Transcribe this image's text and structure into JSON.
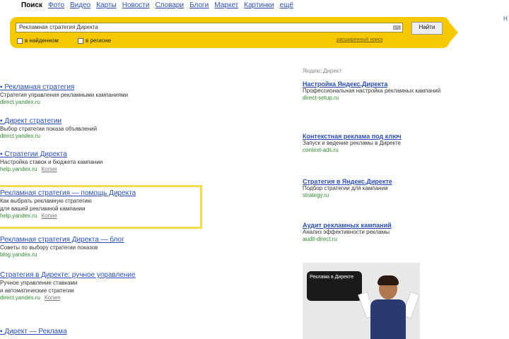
{
  "nav": {
    "items": [
      "Поиск",
      "Фото",
      "Видео",
      "Карты",
      "Новости",
      "Словари",
      "Блоги",
      "Маркет",
      "Картинки",
      "ещё"
    ]
  },
  "search": {
    "query": "Рекламная стратегия Директа",
    "button": "Найти",
    "options": [
      "в найденном",
      "в регионе"
    ],
    "advanced": "расширенный поиск"
  },
  "results": [
    {
      "title": "Рекламная стратегия",
      "snippet": "Стратегия управления рекламными кампаниями",
      "url": "direct.yandex.ru"
    },
    {
      "title": "Директ стратегии",
      "snippet": "Выбор стратегии показа объявлений",
      "url": "direct.yandex.ru"
    },
    {
      "title": "Стратегии Директа",
      "snippet": "Настройка ставок и бюджета кампании",
      "url": "help.yandex.ru",
      "copy": "Копия"
    },
    {
      "title": "Рекламная стратегия — помощь Директа",
      "snippet1": "Как выбрать рекламную стратегию",
      "snippet2": "для вашей рекламной кампании",
      "url": "help.yandex.ru",
      "copy": "Копия"
    },
    {
      "title": "Рекламная стратегия Директа — блог",
      "snippet": "Советы по выбору стратегии показов",
      "url": "blog.yandex.ru"
    },
    {
      "title": "Стратегия в Директе: ручное управление",
      "snippet1": "Ручное управление ставками",
      "snippet2": "и автоматические стратегии",
      "url": "direct.yandex.ru",
      "copy": "Копия"
    },
    {
      "title": "Директ — Реклама",
      "snippet": "",
      "url": ""
    }
  ],
  "ads": {
    "header": "Яндекс.Директ",
    "items": [
      {
        "title": "Настройка Яндекс.Директа",
        "snippet": "Профессиональная настройка рекламных кампаний",
        "url": "direct-setup.ru"
      },
      {
        "title": "Контекстная реклама под ключ",
        "snippet": "Запуск и ведение рекламы в Директе",
        "url": "context-ads.ru"
      },
      {
        "title": "Стратегия в Яндекс.Директе",
        "snippet": "Подбор стратегии для кампании",
        "url": "strategy.ru"
      },
      {
        "title": "Аудит рекламных кампаний",
        "snippet": "Анализ эффективности рекламы",
        "url": "audit-direct.ru"
      }
    ]
  },
  "banner": {
    "text": "Реклама в Директе"
  }
}
